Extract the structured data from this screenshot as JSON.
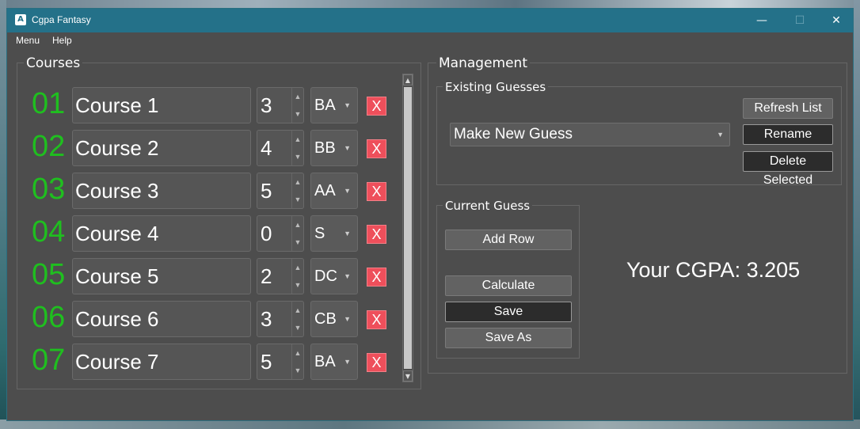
{
  "window": {
    "title": "Cgpa Fantasy",
    "icon": "app-icon",
    "icon_glyph": "A"
  },
  "window_controls": {
    "minimize": "—",
    "maximize": "☐",
    "close": "✕"
  },
  "menubar": {
    "menu": "Menu",
    "help": "Help"
  },
  "courses": {
    "title": "Courses",
    "delete_label": "X",
    "rows": [
      {
        "num": "01",
        "name": "Course 1",
        "credit": "3",
        "grade": "BA"
      },
      {
        "num": "02",
        "name": "Course 2",
        "credit": "4",
        "grade": "BB"
      },
      {
        "num": "03",
        "name": "Course 3",
        "credit": "5",
        "grade": "AA"
      },
      {
        "num": "04",
        "name": "Course 4",
        "credit": "0",
        "grade": "S"
      },
      {
        "num": "05",
        "name": "Course 5",
        "credit": "2",
        "grade": "DC"
      },
      {
        "num": "06",
        "name": "Course 6",
        "credit": "3",
        "grade": "CB"
      },
      {
        "num": "07",
        "name": "Course 7",
        "credit": "5",
        "grade": "BA"
      }
    ]
  },
  "management": {
    "title": "Management",
    "existing": {
      "title": "Existing Guesses",
      "selected": "Make New Guess",
      "refresh": "Refresh List",
      "rename": "Rename",
      "delete": "Delete Selected"
    },
    "current": {
      "title": "Current Guess",
      "add_row": "Add Row",
      "calculate": "Calculate",
      "save": "Save",
      "save_as": "Save As"
    },
    "cgpa_text": "Your CGPA: 3.205"
  },
  "colors": {
    "titlebar": "#247189",
    "row_number": "#1fbf1f",
    "delete_button": "#ee4f5b",
    "window_bg": "#4d4d4d"
  }
}
